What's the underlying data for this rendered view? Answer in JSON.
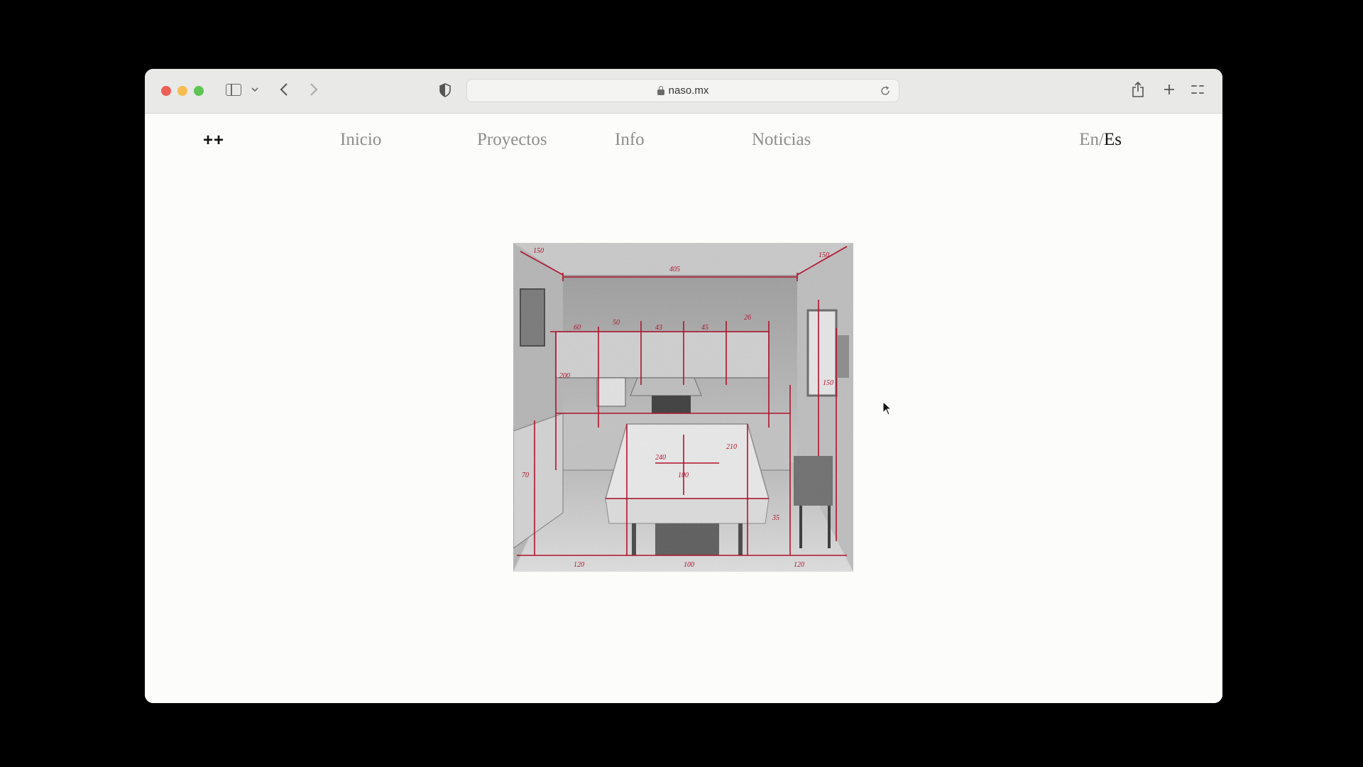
{
  "browser": {
    "url": "naso.mx"
  },
  "site": {
    "logo": "++",
    "nav": [
      {
        "label": "Inicio"
      },
      {
        "label": "Proyectos"
      },
      {
        "label": "Info"
      },
      {
        "label": "Noticias"
      }
    ],
    "lang": {
      "en": "En",
      "sep": "/",
      "es": "Es",
      "active": "Es"
    }
  },
  "hero": {
    "measurements": [
      "405",
      "150",
      "150",
      "200",
      "60",
      "50",
      "43",
      "45",
      "26",
      "150",
      "240",
      "210",
      "100",
      "120",
      "100",
      "120",
      "35",
      "70"
    ]
  },
  "colors": {
    "annotation_red": "#b0122a",
    "window_bg": "#fcfcfb",
    "toolbar_bg": "#e9e9e8"
  }
}
